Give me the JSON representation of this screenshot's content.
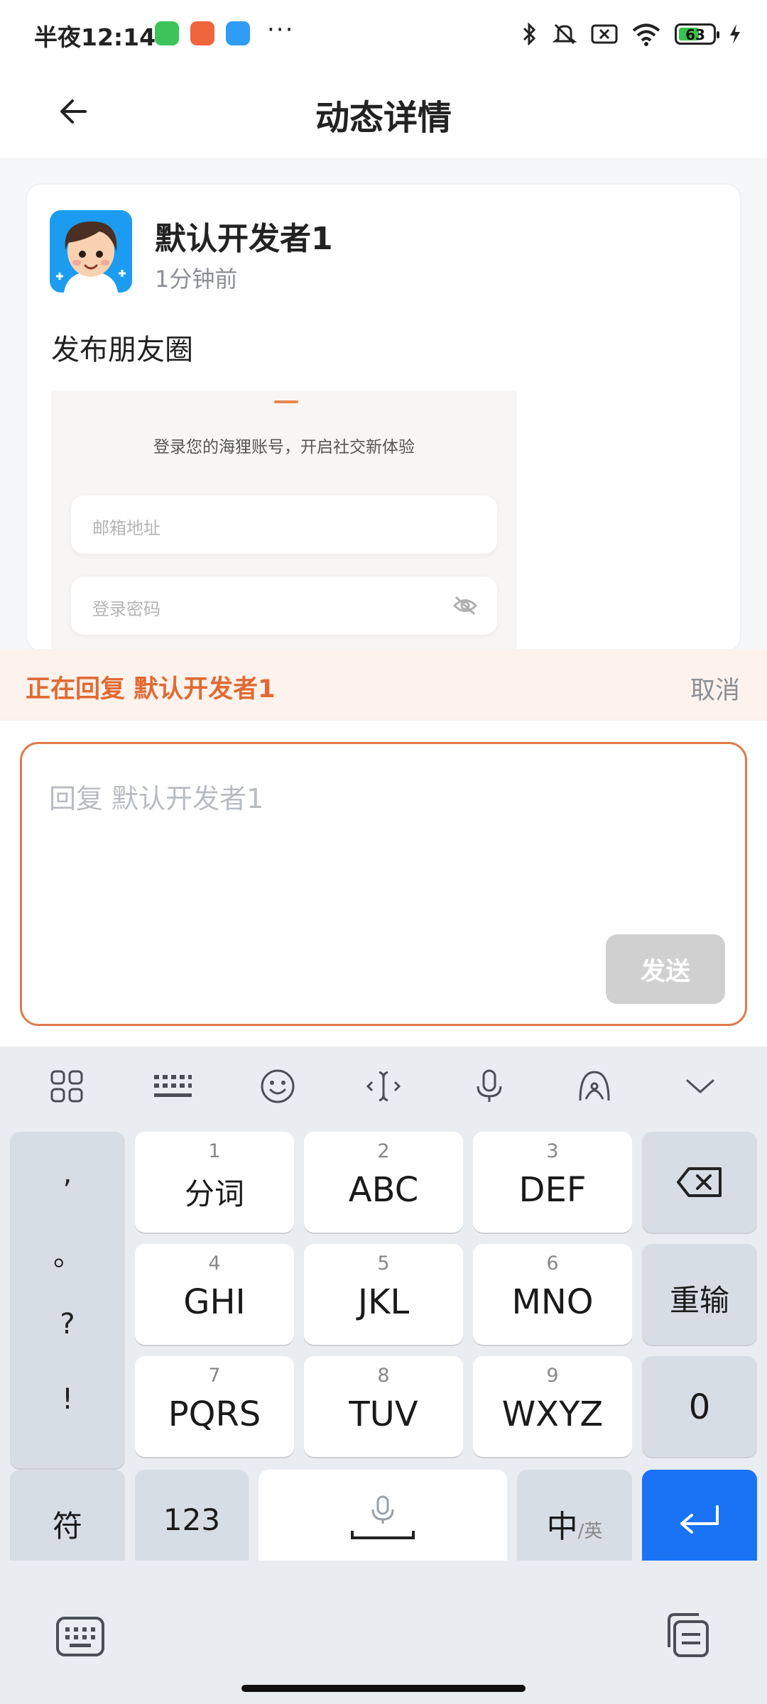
{
  "status_bar": {
    "time": "半夜12:14",
    "dots": "···",
    "battery": "63"
  },
  "header": {
    "title": "动态详情"
  },
  "post": {
    "author": "默认开发者1",
    "time": "1分钟前",
    "text": "发布朋友圈",
    "image": {
      "subtitle": "登录您的海狸账号，开启社交新体验",
      "email_placeholder": "邮箱地址",
      "password_placeholder": "登录密码"
    }
  },
  "reply": {
    "banner": "正在回复 默认开发者1",
    "cancel": "取消",
    "placeholder": "回复 默认开发者1",
    "send": "发送"
  },
  "keyboard": {
    "punct": [
      ",",
      "。",
      "?",
      "!"
    ],
    "keys": [
      {
        "num": "1",
        "label": "分词"
      },
      {
        "num": "2",
        "label": "ABC"
      },
      {
        "num": "3",
        "label": "DEF"
      },
      {
        "num": "4",
        "label": "GHI"
      },
      {
        "num": "5",
        "label": "JKL"
      },
      {
        "num": "6",
        "label": "MNO"
      },
      {
        "num": "7",
        "label": "PQRS"
      },
      {
        "num": "8",
        "label": "TUV"
      },
      {
        "num": "9",
        "label": "WXYZ"
      }
    ],
    "reenter": "重输",
    "zero": "0",
    "symbols": "符",
    "numeric": "123",
    "lang_main": "中",
    "lang_sub": "/英"
  },
  "colors": {
    "accent": "#e06a34",
    "enter_key": "#1a73f5"
  }
}
